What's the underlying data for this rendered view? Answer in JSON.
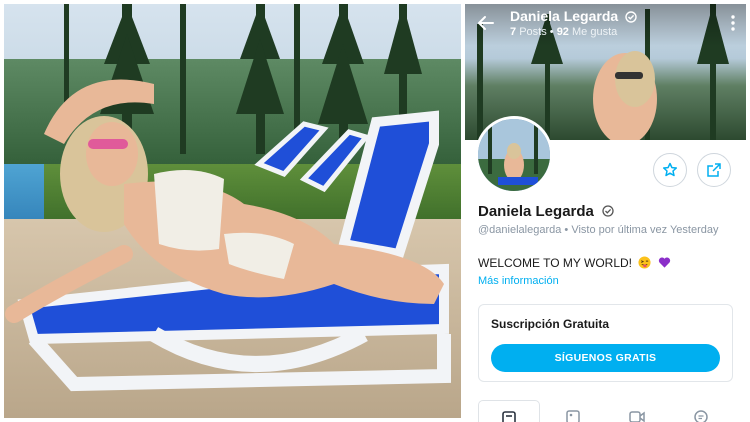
{
  "profile": {
    "name": "Daniela Legarda",
    "posts_count": "7",
    "posts_label": "Posts",
    "likes_count": "92",
    "likes_label": "Me gusta",
    "handle": "@danielalegarda",
    "separator": "•",
    "last_seen": "Visto por última vez Yesterday",
    "bio": "WELCOME TO MY WORLD!",
    "more_info": "Más información"
  },
  "subscription": {
    "title": "Suscripción Gratuita",
    "button_label": "SÍGUENOS GRATIS"
  },
  "colors": {
    "accent": "#00aff0",
    "pool_chair": "#1f4fd8",
    "muted_text": "#8a96a3"
  },
  "icons": {
    "back": "arrow-left-icon",
    "more": "more-vertical-icon",
    "verified": "verified-badge-icon",
    "favorite": "star-icon",
    "share": "share-icon",
    "tabs": [
      "posts-icon",
      "photos-icon",
      "videos-icon",
      "comments-icon"
    ],
    "bio_emojis": [
      "tongue-wink-emoji-icon",
      "purple-heart-icon"
    ]
  }
}
